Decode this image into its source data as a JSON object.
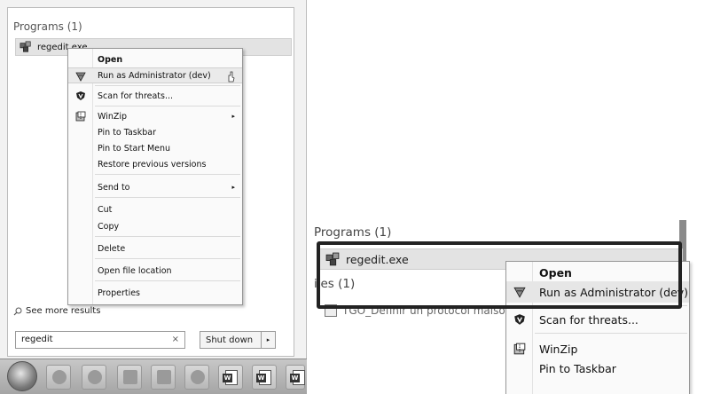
{
  "left": {
    "programs_header": "Programs (1)",
    "program_name": "regedit.exe",
    "see_more": "See more results",
    "search_value": "regedit",
    "search_clear": "×",
    "shutdown_label": "Shut down",
    "shutdown_arrow": "▸",
    "context_menu": {
      "open": "Open",
      "run_as_admin": "Run as Administrator (dev)",
      "scan_threats": "Scan for threats...",
      "winzip": "WinZip",
      "pin_taskbar": "Pin to Taskbar",
      "pin_start": "Pin to Start Menu",
      "restore_versions": "Restore previous versions",
      "send_to": "Send to",
      "cut": "Cut",
      "copy": "Copy",
      "delete": "Delete",
      "open_file_location": "Open file location",
      "properties": "Properties",
      "submenu_arrow": "▸"
    },
    "taskbar_word_glyph": "W"
  },
  "right": {
    "programs_header": "Programs (1)",
    "program_name": "regedit.exe",
    "files_header": "iles (1)",
    "file_name": "TGO_Definir un protocol maison",
    "context_menu": {
      "open": "Open",
      "run_as_admin": "Run as Administrator (dev)",
      "scan_threats": "Scan for threats...",
      "winzip": "WinZip",
      "pin_taskbar": "Pin to Taskbar"
    }
  },
  "colors": {
    "menu_bg": "#fafafa",
    "highlight_border": "#222222",
    "selection_bg": "#e3e3e3"
  }
}
